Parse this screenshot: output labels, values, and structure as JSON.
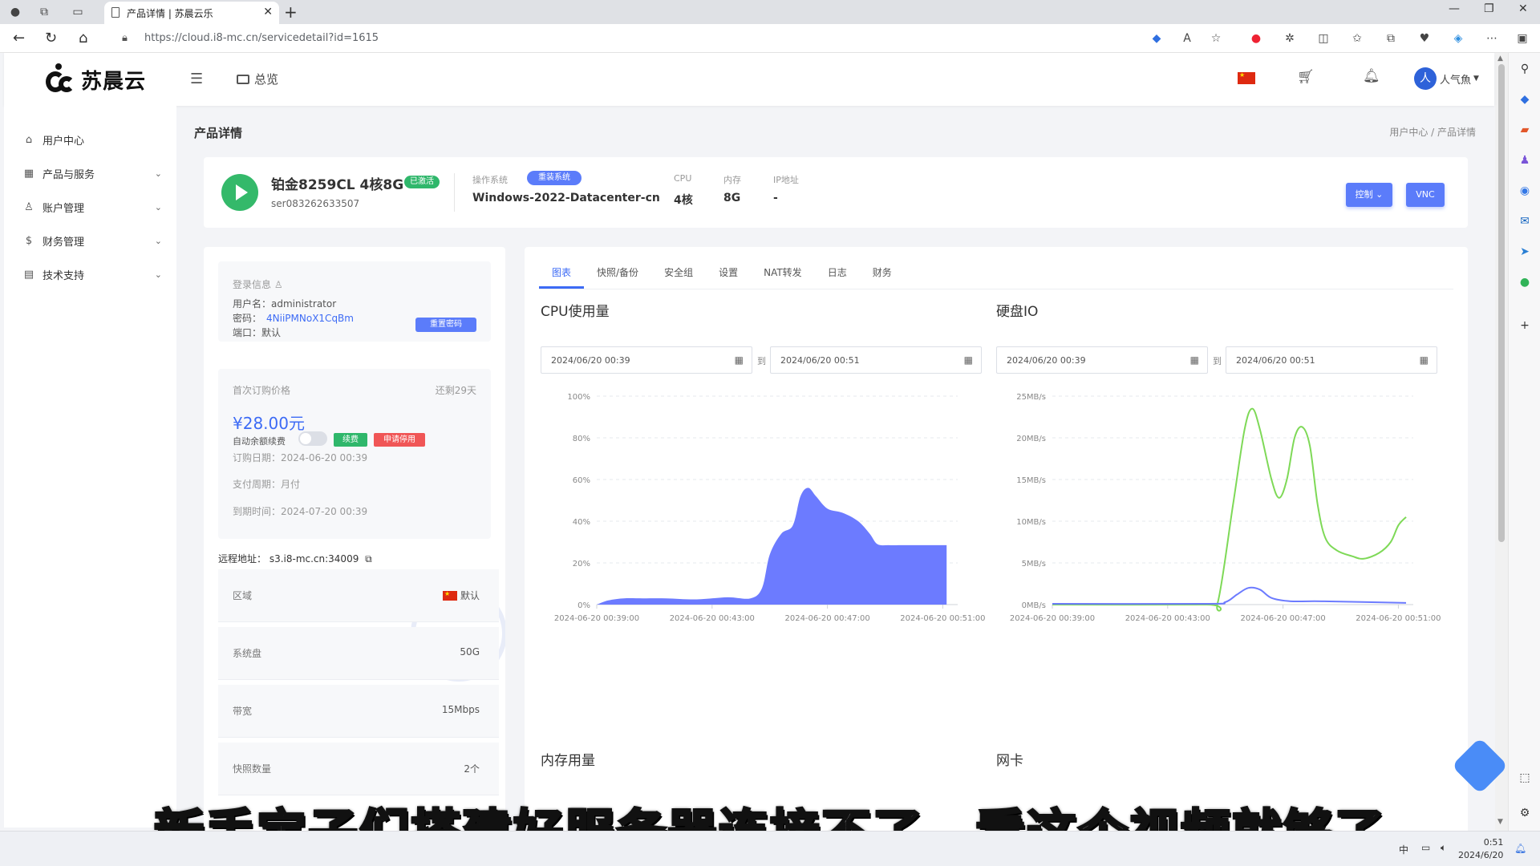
{
  "browser": {
    "tab_title": "产品详情 | 苏晨云乐",
    "url": "https://cloud.i8-mc.cn/servicedetail?id=1615"
  },
  "header": {
    "logo_text": "苏晨云",
    "overview_label": "总览",
    "user_name": "人气魚"
  },
  "menu": {
    "items": [
      {
        "label": "用户中心"
      },
      {
        "label": "产品与服务"
      },
      {
        "label": "账户管理"
      },
      {
        "label": "财务管理"
      },
      {
        "label": "技术支持"
      }
    ]
  },
  "page": {
    "title": "产品详情",
    "breadcrumb": "用户中心 / 产品详情"
  },
  "product": {
    "name": "铂金8259CL 4核8G",
    "status": "已激活",
    "id": "ser083262633507",
    "os_label": "操作系统",
    "os_reinstall": "重装系统",
    "os_value": "Windows-2022-Datacenter-cn",
    "cpu_label": "CPU",
    "cpu_value": "4核",
    "mem_label": "内存",
    "mem_value": "8G",
    "ip_label": "IP地址",
    "ip_value": "-",
    "control_btn": "控制",
    "vnc_btn": "VNC"
  },
  "login": {
    "section": "登录信息",
    "username": "用户名：administrator",
    "password_label": "密码：",
    "password": "4NiiPMNoX1CqBm",
    "port": "端口：默认",
    "reset_btn": "重置密码"
  },
  "billing": {
    "first_price_label": "首次订购价格",
    "remaining": "还剩29天",
    "price": "¥28.00元",
    "auto_renew": "自动余额续费",
    "renew_btn": "续费",
    "stop_btn": "申请停用",
    "order_date": "订购日期：2024-06-20 00:39",
    "pay_cycle": "支付周期：月付",
    "expire": "到期时间：2024-07-20 00:39"
  },
  "remote_addr": "远程地址：  s3.i8-mc.cn:34009",
  "specs": [
    {
      "label": "区域",
      "value": "默认"
    },
    {
      "label": "系统盘",
      "value": "50G"
    },
    {
      "label": "带宽",
      "value": "15Mbps"
    },
    {
      "label": "快照数量",
      "value": "2个"
    }
  ],
  "tabs": [
    "图表",
    "快照/备份",
    "安全组",
    "设置",
    "NAT转发",
    "日志",
    "财务"
  ],
  "cpu_section": {
    "title": "CPU使用量",
    "from": "2024/06/20 00:39",
    "to_label": "到",
    "to": "2024/06/20 00:51"
  },
  "disk_section": {
    "title": "硬盘IO",
    "from": "2024/06/20 00:39",
    "to_label": "到",
    "to": "2024/06/20 00:51"
  },
  "mem_section": {
    "title": "内存用量"
  },
  "net_section": {
    "title": "网卡"
  },
  "chart_data": [
    {
      "type": "area",
      "title": "CPU使用量",
      "x": [
        "2024-06-20 00:39:00",
        "2024-06-20 00:43:00",
        "2024-06-20 00:47:00",
        "2024-06-20 00:51:00"
      ],
      "ylim": [
        0,
        100
      ],
      "yticks": [
        "0%",
        "20%",
        "40%",
        "60%",
        "80%",
        "100%"
      ],
      "series": [
        {
          "color": "#6c7bff",
          "points": [
            [
              0,
              0
            ],
            [
              0.3,
              2
            ],
            [
              0.7,
              3
            ],
            [
              1.2,
              3
            ],
            [
              1.8,
              3
            ],
            [
              2.6,
              2.5
            ],
            [
              3.4,
              3.5
            ],
            [
              4.0,
              3
            ],
            [
              4.3,
              8
            ],
            [
              4.5,
              24
            ],
            [
              4.8,
              34
            ],
            [
              5.1,
              38
            ],
            [
              5.3,
              52
            ],
            [
              5.5,
              56
            ],
            [
              5.7,
              52
            ],
            [
              6.0,
              46
            ],
            [
              6.4,
              44
            ],
            [
              6.8,
              40
            ],
            [
              7.1,
              34
            ],
            [
              7.3,
              29
            ],
            [
              7.6,
              28.5
            ],
            [
              8.0,
              28.5
            ],
            [
              8.6,
              28.5
            ],
            [
              9.1,
              28.5
            ]
          ]
        }
      ]
    },
    {
      "type": "line",
      "title": "硬盘IO",
      "x": [
        "2024-06-20 00:39:00",
        "2024-06-20 00:43:00",
        "2024-06-20 00:47:00",
        "2024-06-20 00:51:00"
      ],
      "ylim": [
        0,
        25
      ],
      "yticks": [
        "0MB/s",
        "5MB/s",
        "10MB/s",
        "15MB/s",
        "20MB/s",
        "25MB/s"
      ],
      "series": [
        {
          "color": "#7ed957",
          "points": [
            [
              0,
              0
            ],
            [
              4.0,
              0
            ],
            [
              4.3,
              0.2
            ],
            [
              4.7,
              12
            ],
            [
              5.0,
              21
            ],
            [
              5.2,
              23.5
            ],
            [
              5.4,
              21
            ],
            [
              5.7,
              15
            ],
            [
              5.9,
              12.8
            ],
            [
              6.1,
              15
            ],
            [
              6.3,
              20
            ],
            [
              6.5,
              21.3
            ],
            [
              6.7,
              19
            ],
            [
              6.9,
              12
            ],
            [
              7.1,
              8
            ],
            [
              7.4,
              6.5
            ],
            [
              7.8,
              5.8
            ],
            [
              8.1,
              5.5
            ],
            [
              8.5,
              6.2
            ],
            [
              8.8,
              7.5
            ],
            [
              9.0,
              9.5
            ],
            [
              9.2,
              10.5
            ]
          ]
        },
        {
          "color": "#6c7bff",
          "points": [
            [
              0,
              0.1
            ],
            [
              4.0,
              0.1
            ],
            [
              4.5,
              0.3
            ],
            [
              4.8,
              1.2
            ],
            [
              5.1,
              2.0
            ],
            [
              5.4,
              1.8
            ],
            [
              5.7,
              0.8
            ],
            [
              6.2,
              0.4
            ],
            [
              7.0,
              0.4
            ],
            [
              9.2,
              0.2
            ]
          ]
        }
      ]
    }
  ],
  "subtitle": "新手宝子们搭建好服务器连接不了，看这个视频就够了",
  "clock": {
    "time": "0:51",
    "date": "2024/6/20"
  },
  "tray": {
    "ime": "中"
  }
}
